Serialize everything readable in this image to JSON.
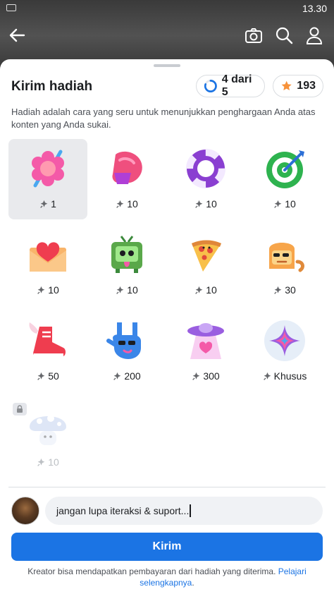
{
  "status_bar": {
    "time": "13.30"
  },
  "sheet": {
    "title": "Kirim hadiah",
    "progress_label": "4 dari 5",
    "progress_fraction": 0.8,
    "stars_count": "193",
    "description": "Hadiah adalah cara yang seru untuk menunjukkan penghargaan Anda atas konten yang Anda sukai."
  },
  "gifts": [
    {
      "icon": "flower-gift-icon",
      "price": "1",
      "selected": true
    },
    {
      "icon": "boxing-glove-gift-icon",
      "price": "10"
    },
    {
      "icon": "lifebuoy-gift-icon",
      "price": "10"
    },
    {
      "icon": "target-gift-icon",
      "price": "10"
    },
    {
      "icon": "love-letter-gift-icon",
      "price": "10"
    },
    {
      "icon": "tv-monster-gift-icon",
      "price": "10"
    },
    {
      "icon": "pizza-gift-icon",
      "price": "10"
    },
    {
      "icon": "bread-cat-gift-icon",
      "price": "30"
    },
    {
      "icon": "winged-shoe-gift-icon",
      "price": "50"
    },
    {
      "icon": "rock-hand-gift-icon",
      "price": "200"
    },
    {
      "icon": "ufo-gift-icon",
      "price": "300"
    },
    {
      "icon": "sparkle-gift-icon",
      "price": "Khusus"
    },
    {
      "icon": "mushroom-gift-icon",
      "price": "10",
      "locked": true
    }
  ],
  "message": {
    "value": "jangan lupa iteraksi & suport..."
  },
  "send_label": "Kirim",
  "footer": {
    "text": "Kreator bisa mendapatkan pembayaran dari hadiah yang diterima. ",
    "link": "Pelajari selengkapnya",
    "end": "."
  },
  "colors": {
    "accent": "#1b74e4",
    "star": "#f7923a"
  }
}
